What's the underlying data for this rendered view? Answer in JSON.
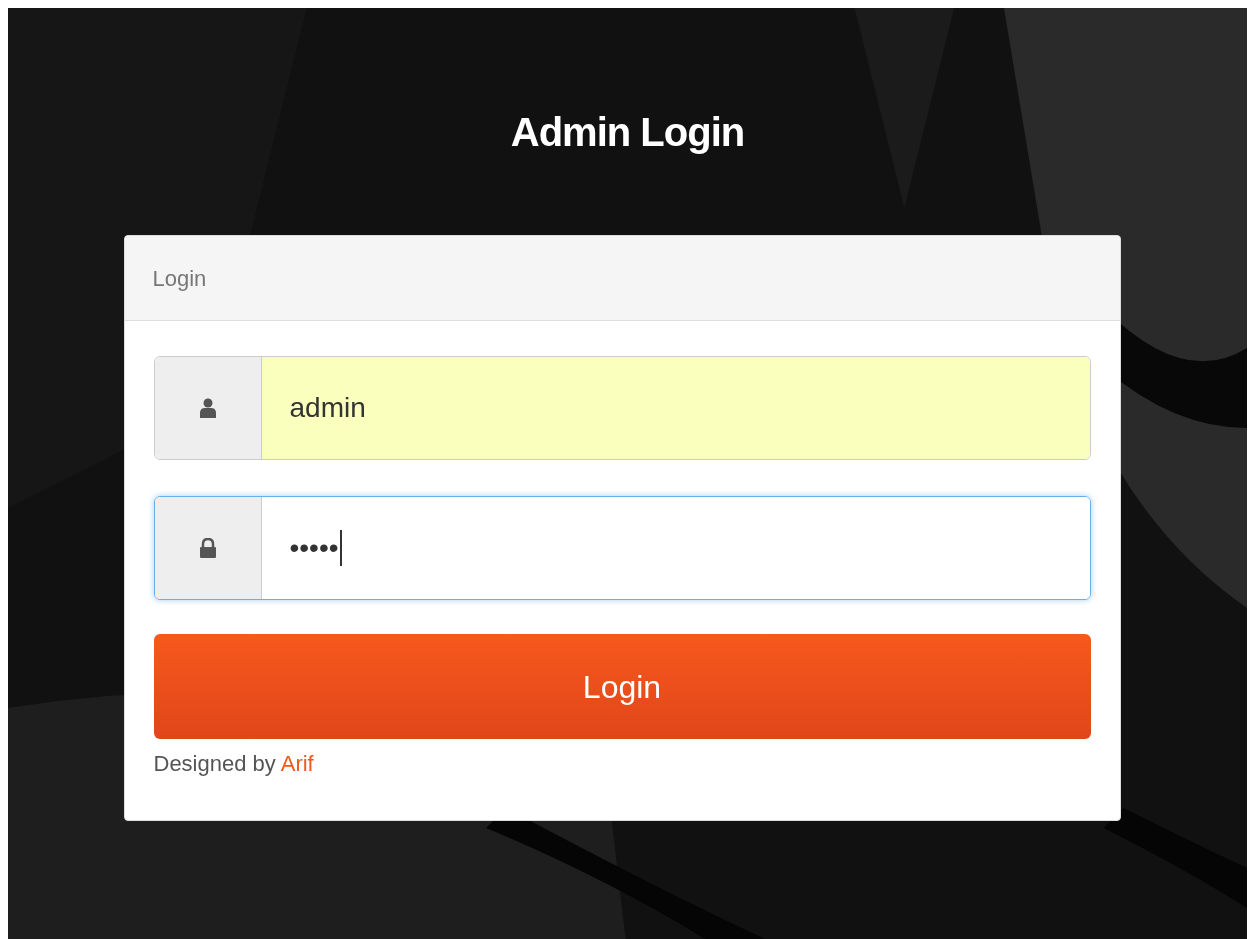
{
  "title": "Admin Login",
  "panel": {
    "heading": "Login",
    "fields": [
      {
        "kind": "user",
        "value": "admin",
        "autofilled": true,
        "focused": false
      },
      {
        "kind": "password",
        "value": "•••••",
        "autofilled": false,
        "focused": true
      }
    ],
    "button": "Login",
    "credit": {
      "text": "Designed by",
      "link": "Arif"
    }
  }
}
